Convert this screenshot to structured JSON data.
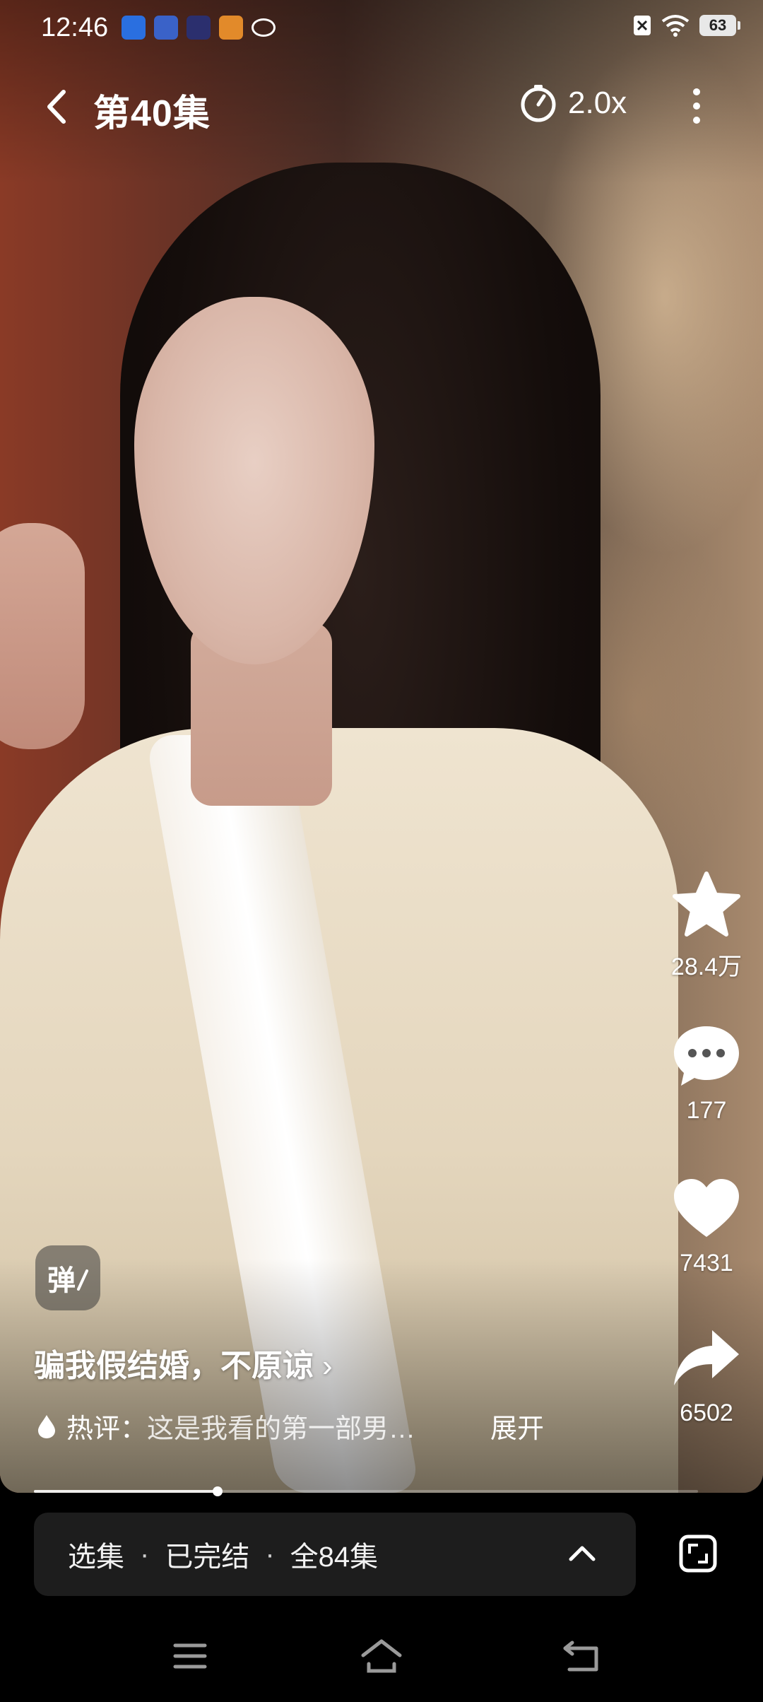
{
  "status_bar": {
    "time": "12:46",
    "battery": "63",
    "notification_icons": [
      "baidu-icon",
      "news-icon",
      "video-app-icon",
      "game-app-icon",
      "link-icon"
    ]
  },
  "top_bar": {
    "title": "第40集",
    "speed": "2.0x"
  },
  "actions": {
    "favorite_count": "28.4万",
    "comment_count": "177",
    "like_count": "7431",
    "share_count": "6502"
  },
  "danmaku": {
    "label": "弹"
  },
  "series": {
    "title": "骗我假结婚，不原谅",
    "hot_comment_label": "热评：",
    "hot_comment_text": "这是我看的第一部男…",
    "expand_label": "展开"
  },
  "progress": {
    "value": 0.277
  },
  "episode_panel": {
    "select": "选集",
    "status": "已完结",
    "total": "全84集",
    "separator": "·"
  },
  "colors": {
    "background": "#000000",
    "panel": "#1d1d1d"
  }
}
